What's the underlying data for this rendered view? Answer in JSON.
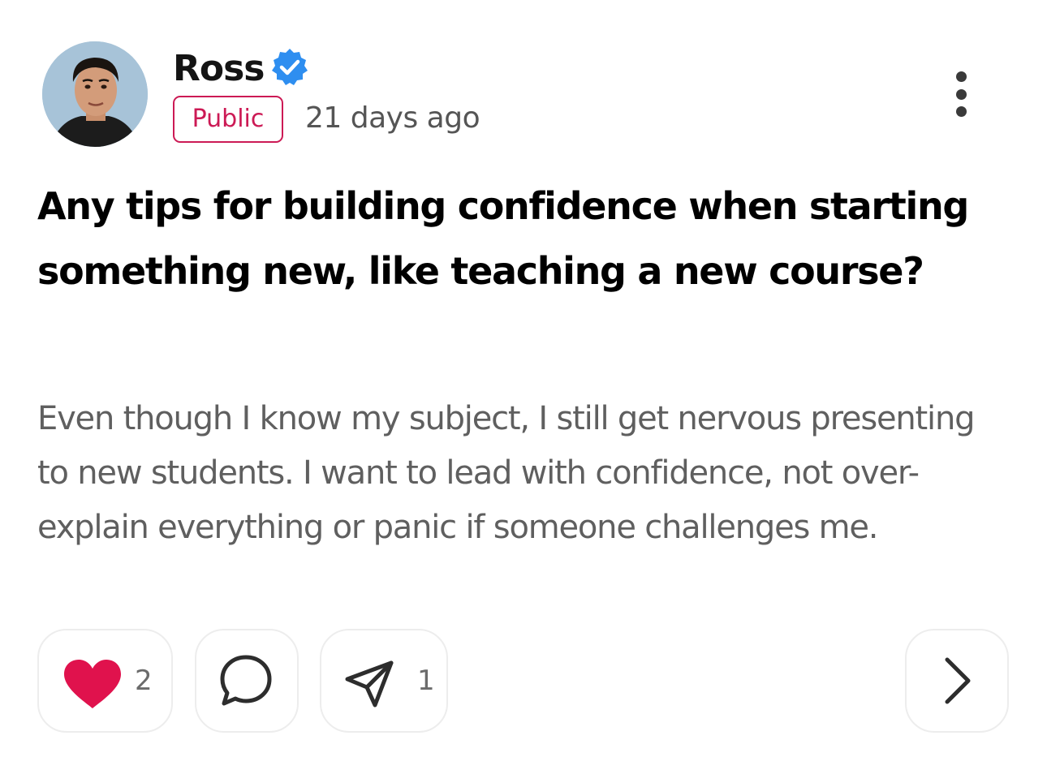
{
  "post": {
    "author": {
      "name": "Ross",
      "verified": true,
      "avatar_icon": "avatar-photo"
    },
    "visibility": "Public",
    "timestamp": "21 days ago",
    "title": "Any tips for building confidence when starting something new, like teaching a new course?",
    "body": "Even though I know my subject, I still get nervous presenting to new students. I want to lead with confidence, not over-explain everything or panic if someone challenges me."
  },
  "actions": {
    "like": {
      "icon": "heart-icon",
      "count": "2",
      "liked": true
    },
    "comment": {
      "icon": "comment-bubble-icon"
    },
    "share": {
      "icon": "send-icon",
      "count": "1"
    },
    "next": {
      "icon": "chevron-right-icon"
    }
  },
  "colors": {
    "accent": "#cc1a55",
    "heart": "#e0124d",
    "verified": "#2e8ef0",
    "body_text": "#5f5f5f",
    "meta_text": "#555555"
  }
}
